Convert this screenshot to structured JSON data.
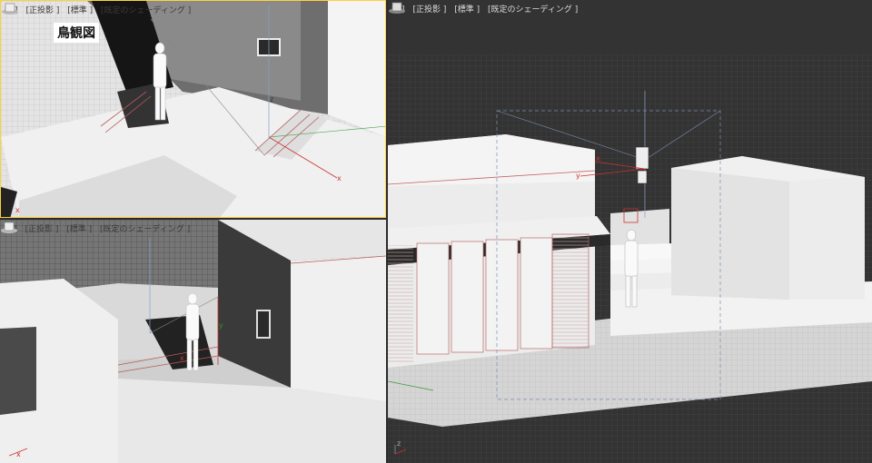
{
  "viewports": {
    "top_left": {
      "labels": [
        "[+]",
        "[正投影 ]",
        "[標準 ]",
        "[既定のシェーディング ]"
      ],
      "overlay_title": "鳥観図",
      "view_cube": "viewcube-icon"
    },
    "bottom_left": {
      "labels": [
        "[+]",
        "[正投影 ]",
        "[標準 ]",
        "[既定のシェーディング ]"
      ],
      "view_cube": "viewcube-icon"
    },
    "right": {
      "labels": [
        "[+]",
        "[正投影 ]",
        "[標準 ]",
        "[既定のシェーディング ]"
      ],
      "view_cube": "viewcube-icon"
    }
  },
  "axes": {
    "x": "x",
    "y": "y",
    "z": "z"
  },
  "colors": {
    "active_border": "#ffd23a",
    "axis_x": "#cc3333",
    "axis_y": "#2a9a2a",
    "dark_bg": "#3a3a3a"
  }
}
